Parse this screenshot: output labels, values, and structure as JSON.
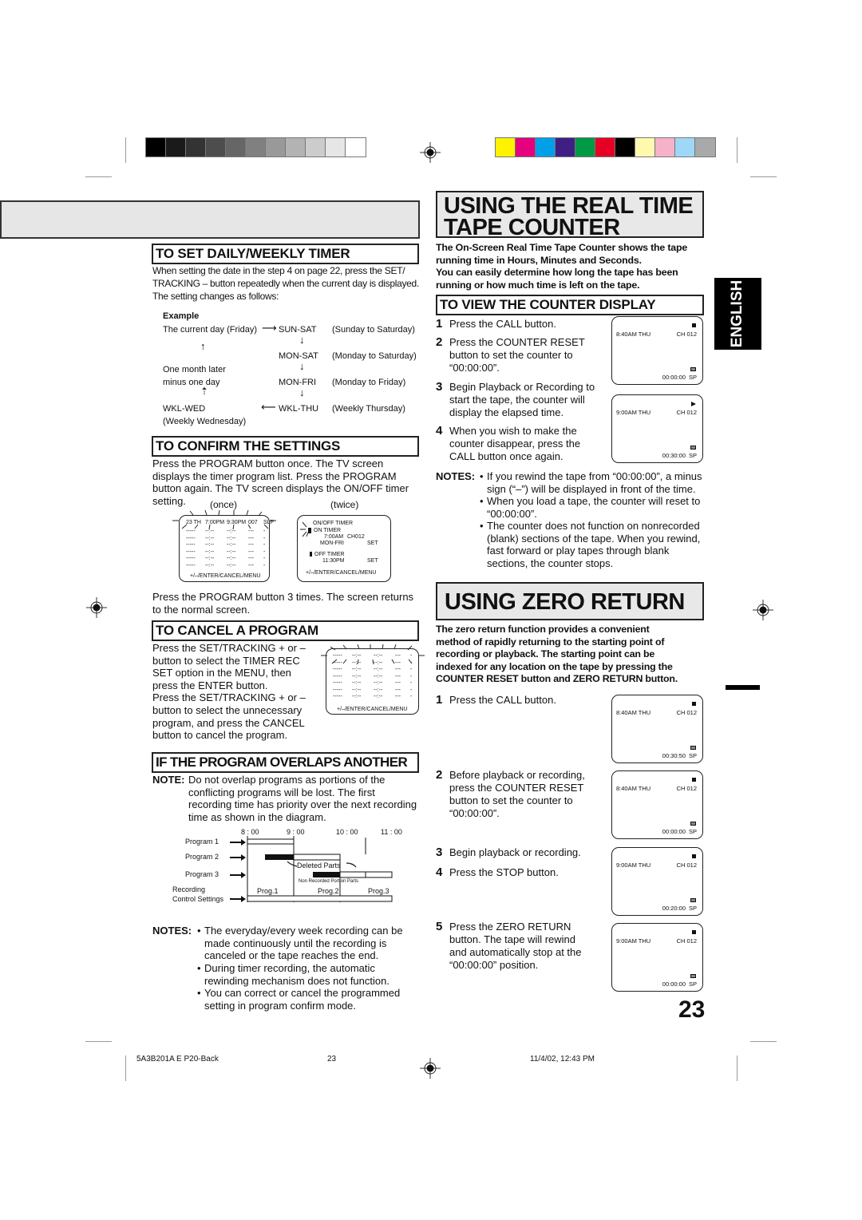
{
  "calibration": {
    "grayscale": [
      "#000000",
      "#1a1a1a",
      "#333333",
      "#4d4d4d",
      "#666666",
      "#808080",
      "#999999",
      "#b3b3b3",
      "#cccccc",
      "#e6e6e6",
      "#ffffff"
    ],
    "colors": [
      "#fff200",
      "#e4007f",
      "#00a0e9",
      "#3f1f84",
      "#009944",
      "#e60026",
      "#000000",
      "#fff9b0",
      "#f5b2c8",
      "#9fd8f7",
      "#a9a9a9"
    ]
  },
  "left": {
    "daily_weekly": {
      "title": "TO SET DAILY/WEEKLY TIMER",
      "intro_line1": "When setting the date in the step 4 on page 22, press the SET/",
      "intro_line2": "TRACKING – button repeatedly when the current day is displayed.",
      "intro_line3": "The setting changes as follows:",
      "example_label": "Example",
      "example": {
        "current_day": "The current day (Friday)",
        "one_month_line1": "One month later",
        "one_month_line2": "minus one day",
        "wkl_wed": "WKL-WED",
        "wkl_wed_desc": "(Weekly Wednesday)",
        "modes": [
          {
            "code": "SUN-SAT",
            "desc": "(Sunday to Saturday)"
          },
          {
            "code": "MON-SAT",
            "desc": "(Monday to Saturday)"
          },
          {
            "code": "MON-FRI",
            "desc": "(Monday to Friday)"
          },
          {
            "code": "WKL-THU",
            "desc": "(Weekly Thursday)"
          }
        ]
      }
    },
    "confirm": {
      "title": "TO CONFIRM THE SETTINGS",
      "line1": "Press the PROGRAM button once. The TV screen",
      "line2": "displays the timer program list. Press the PROGRAM",
      "line3": "button again. The TV screen displays the ON/OFF timer",
      "line4": "setting.",
      "once_label": "(once)",
      "twice_label": "(twice)",
      "once_screen": {
        "header": [
          "23 TH",
          "7:00PM",
          "9:30PM",
          "007",
          "SLP"
        ],
        "blank_row": [
          "-----",
          "--:--",
          "--:--",
          "---",
          "-"
        ],
        "footer": "+/–/ENTER/CANCEL/MENU"
      },
      "twice_screen": {
        "title": "ON/OFF  TIMER",
        "on_timer": "ON  TIMER",
        "on_time": "7:00AM",
        "on_channel": "CH012",
        "on_days": "MON-FRI",
        "on_set": "SET",
        "off_timer": "OFF  TIMER",
        "off_time": "11:30PM",
        "off_set": "SET",
        "footer": "+/–/ENTER/CANCEL/MENU"
      },
      "after_line1": "Press the PROGRAM button 3 times. The screen returns",
      "after_line2": "to the normal screen."
    },
    "cancel": {
      "title": "TO CANCEL A PROGRAM",
      "lines": [
        "Press the SET/TRACKING + or –",
        "button to select the TIMER REC",
        "SET option in the MENU, then",
        "press the ENTER button.",
        "Press the SET/TRACKING + or –",
        "button to select the unnecessary",
        "program, and press the CANCEL",
        "button to cancel the program."
      ],
      "screen": {
        "blank_row": [
          "-----",
          "--:--",
          "--:--",
          "---",
          "-"
        ],
        "footer": "+/–/ENTER/CANCEL/MENU"
      }
    },
    "overlap": {
      "title": "IF THE PROGRAM OVERLAPS ANOTHER",
      "note_label": "NOTE:",
      "note_lines": [
        "Do not overlap programs as portions of the",
        "conflicting programs will be lost. The first",
        "recording time has priority over the next recording",
        "time as shown in the diagram."
      ],
      "diagram": {
        "times": [
          "8 : 00",
          "9 : 00",
          "10 : 00",
          "11 : 00"
        ],
        "rows": [
          "Program 1",
          "Program 2",
          "Program 3"
        ],
        "recording_label_1": "Recording",
        "recording_label_2": "Control Settings",
        "deleted_parts": "Deleted Parts",
        "non_recorded": "Non Recorded Portion Parts",
        "result": [
          "Prog.1",
          "Prog.2",
          "Prog.3"
        ]
      },
      "notes_label": "NOTES:",
      "notes": [
        [
          "The everyday/every week recording can be",
          "made continuously until the recording is",
          "canceled or the tape reaches the end."
        ],
        [
          "During timer recording, the automatic",
          "rewinding mechanism does not function."
        ],
        [
          "You can correct or cancel the programmed",
          "setting in program confirm mode."
        ]
      ]
    }
  },
  "right": {
    "counter": {
      "title_line1": "USING THE REAL TIME",
      "title_line2": "TAPE COUNTER",
      "intro": [
        "The On-Screen Real Time Tape Counter shows the tape",
        "running time in Hours, Minutes and Seconds.",
        "You can easily determine how long the tape has been",
        "running or how much time is left on the tape."
      ],
      "view_title": "TO VIEW THE COUNTER DISPLAY",
      "steps": [
        {
          "num": "1",
          "lines": [
            "Press the CALL button."
          ]
        },
        {
          "num": "2",
          "lines": [
            "Press the COUNTER RESET",
            "button to set the counter to",
            "“00:00:00”."
          ]
        },
        {
          "num": "3",
          "lines": [
            "Begin Playback or Recording to",
            "start the tape, the counter will",
            "display the elapsed time."
          ]
        },
        {
          "num": "4",
          "lines": [
            "When you wish to make the",
            "counter disappear, press the",
            "CALL button once again."
          ]
        }
      ],
      "screens": [
        {
          "time": "8:40AM  THU",
          "channel": "CH 012",
          "counter": "00:00:00",
          "speed": "SP",
          "state_icon": "stop"
        },
        {
          "time": "9:00AM  THU",
          "channel": "CH 012",
          "counter": "00:30:00",
          "speed": "SP",
          "state_icon": "play"
        }
      ],
      "notes_label": "NOTES:",
      "notes": [
        [
          "If you rewind the tape from “00:00:00”, a minus",
          "sign (“–”) will be displayed in front of the time."
        ],
        [
          "When you load a tape, the counter will reset to",
          "“00:00:00”."
        ],
        [
          "The counter does not function on nonrecorded",
          "(blank) sections of the tape. When you rewind,",
          "fast forward or play tapes through blank",
          "sections, the counter stops."
        ]
      ]
    },
    "zero": {
      "title": "USING ZERO RETURN",
      "intro": [
        "The zero return function provides a convenient",
        "method of rapidly returning to the starting point of",
        "recording or playback. The starting point can be",
        "indexed for any location on the tape by pressing the",
        "COUNTER RESET button and ZERO RETURN button."
      ],
      "steps": [
        {
          "num": "1",
          "lines": [
            "Press the CALL button."
          ]
        },
        {
          "num": "2",
          "lines": [
            "Before playback or recording,",
            "press the COUNTER RESET",
            "button to set the counter to",
            "“00:00:00”."
          ]
        },
        {
          "num": "3",
          "lines": [
            "Begin playback or recording."
          ]
        },
        {
          "num": "4",
          "lines": [
            "Press the STOP button."
          ]
        },
        {
          "num": "5",
          "lines": [
            "Press the ZERO RETURN",
            "button. The tape will rewind",
            "and automatically stop at the",
            "“00:00:00” position."
          ]
        }
      ],
      "screens": [
        {
          "time": "8:40AM  THU",
          "channel": "CH 012",
          "counter": "00:30:50",
          "speed": "SP",
          "state_icon": "stop"
        },
        {
          "time": "8:40AM  THU",
          "channel": "CH 012",
          "counter": "00:00:00",
          "speed": "SP",
          "state_icon": "stop"
        },
        {
          "time": "9:00AM  THU",
          "channel": "CH 012",
          "counter": "00:20:00",
          "speed": "SP",
          "state_icon": "stop"
        },
        {
          "time": "9:00AM  THU",
          "channel": "CH 012",
          "counter": "00:00:00",
          "speed": "SP",
          "state_icon": "stop"
        }
      ]
    },
    "language_tab": "ENGLISH",
    "page_number": "23"
  },
  "footer": {
    "job": "5A3B201A E P20-Back",
    "page": "23",
    "timestamp": "11/4/02, 12:43 PM"
  }
}
